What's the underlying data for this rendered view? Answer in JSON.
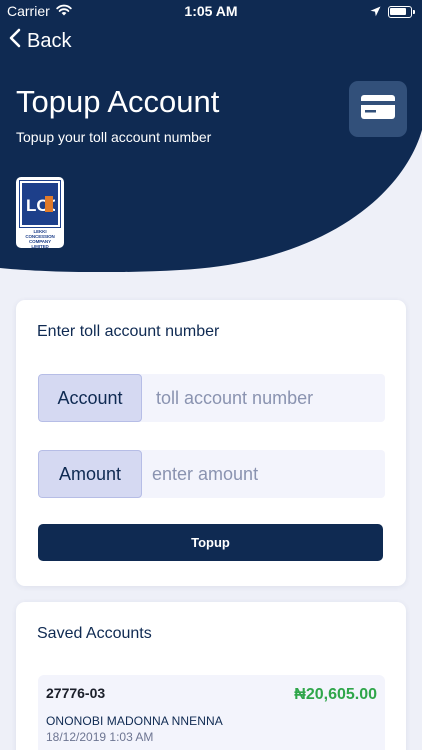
{
  "status_bar": {
    "carrier": "Carrier",
    "time": "1:05 AM",
    "battery_level": 0.85
  },
  "nav": {
    "back_label": "Back"
  },
  "header": {
    "title": "Topup Account",
    "subtitle": "Topup your toll account number",
    "logo_text": "LCC",
    "logo_caption": "LEKKI CONCESSION COMPANY LIMITED"
  },
  "form": {
    "title": "Enter toll account number",
    "account_label": "Account",
    "account_placeholder": "toll account number",
    "amount_label": "Amount",
    "amount_placeholder": "enter amount",
    "submit_label": "Topup"
  },
  "saved": {
    "title": "Saved Accounts",
    "items": [
      {
        "number": "27776-03",
        "amount": "₦20,605.00",
        "name": "ONONOBI MADONNA NNENNA",
        "date": "18/12/2019 1:03 AM"
      }
    ]
  },
  "colors": {
    "header": "#0f2a52",
    "accent_green": "#2fa64a",
    "label_bg": "#d5d9f2",
    "page_bg": "#eef0f8"
  },
  "icons": [
    "wifi-icon",
    "location-arrow-icon",
    "battery-icon",
    "chevron-left-icon",
    "credit-card-icon"
  ]
}
